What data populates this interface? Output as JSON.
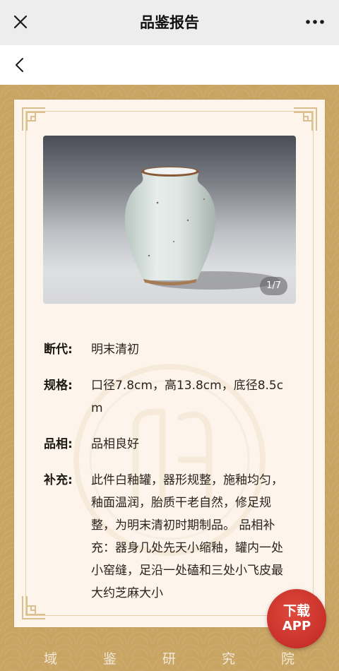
{
  "navbar": {
    "title": "品鉴报告",
    "close_icon": "close-icon",
    "more_icon": "more-dots-icon"
  },
  "backrow": {
    "back_icon": "chevron-left-icon"
  },
  "photo": {
    "counter": "1/7"
  },
  "info": {
    "rows": [
      {
        "label": "断代:",
        "value": "明末清初"
      },
      {
        "label": "规格:",
        "value": "口径7.8cm，高13.8cm，底径8.5cm"
      },
      {
        "label": "品相:",
        "value": "品相良好"
      },
      {
        "label": "补充:",
        "value": "此件白釉罐，器形规整，施釉均匀，釉面温润，胎质干老自然，修足规整，为明末清初时期制品。 品相补充：器身几处先天小缩釉，罐内一处小窑缝，足沿一处磕和三处小飞皮最大约芝麻大小"
      }
    ]
  },
  "download": {
    "line1": "下载",
    "line2": "APP"
  },
  "footer": {
    "chars": [
      "域",
      "鉴",
      "研",
      "究",
      "院"
    ]
  },
  "colors": {
    "gold_background": "#c9a564",
    "card_background": "#fdf5ec",
    "frame_line": "#e7cfa8",
    "badge_red": "#c9302a"
  }
}
